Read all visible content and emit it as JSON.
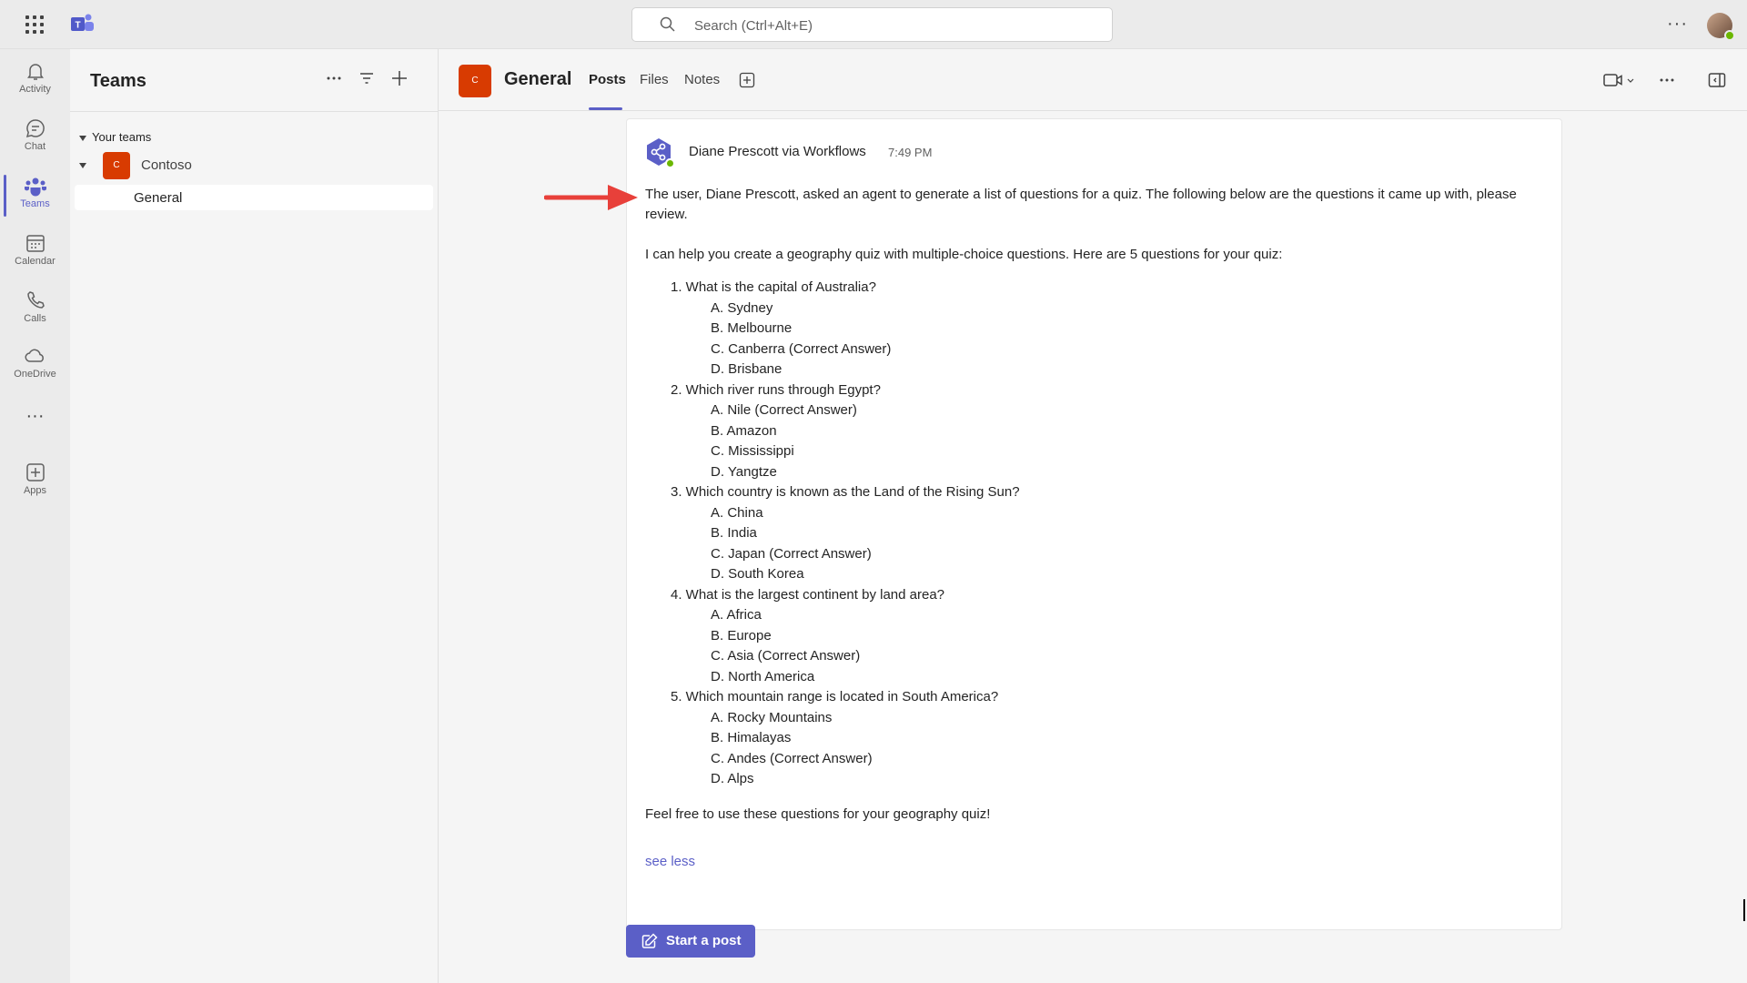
{
  "topbar": {
    "search_placeholder": "Search (Ctrl+Alt+E)",
    "more_label": "···"
  },
  "rail": {
    "items": [
      {
        "label": "Activity",
        "icon": "bell-icon"
      },
      {
        "label": "Chat",
        "icon": "chat-icon"
      },
      {
        "label": "Teams",
        "icon": "teams-icon",
        "active": true
      },
      {
        "label": "Calendar",
        "icon": "calendar-icon"
      },
      {
        "label": "Calls",
        "icon": "phone-icon"
      },
      {
        "label": "OneDrive",
        "icon": "cloud-icon"
      },
      {
        "label": "Apps",
        "icon": "add-app-icon"
      }
    ],
    "more_label": "···"
  },
  "teams_panel": {
    "title": "Teams",
    "section": "Your teams",
    "team": {
      "initial": "C",
      "name": "Contoso"
    },
    "channel": "General"
  },
  "channel_header": {
    "initial": "C",
    "name": "General",
    "tabs": [
      "Posts",
      "Files",
      "Notes"
    ],
    "active_tab": "Posts"
  },
  "post": {
    "author": "Diane Prescott via Workflows",
    "time": "7:49 PM",
    "intro": "The user, Diane Prescott, asked an agent to generate a list of questions for a quiz. The following below are the questions it came up with, please review.",
    "lead": "I can help you create a geography quiz with multiple-choice questions. Here are 5 questions for your quiz:",
    "questions": [
      {
        "text": "1. What is the capital of Australia?",
        "options": [
          "A. Sydney",
          "B. Melbourne",
          "C. Canberra (Correct Answer)",
          "D. Brisbane"
        ]
      },
      {
        "text": "2. Which river runs through Egypt?",
        "options": [
          "A. Nile (Correct Answer)",
          "B. Amazon",
          "C. Mississippi",
          "D. Yangtze"
        ]
      },
      {
        "text": "3. Which country is known as the Land of the Rising Sun?",
        "options": [
          "A. China",
          "B. India",
          "C. Japan (Correct Answer)",
          "D. South Korea"
        ]
      },
      {
        "text": "4. What is the largest continent by land area?",
        "options": [
          "A. Africa",
          "B. Europe",
          "C. Asia (Correct Answer)",
          "D. North America"
        ]
      },
      {
        "text": "5. Which mountain range is located in South America?",
        "options": [
          "A. Rocky Mountains",
          "B. Himalayas",
          "C. Andes (Correct Answer)",
          "D. Alps"
        ]
      }
    ],
    "closing": "Feel free to use these questions for your geography quiz!",
    "see_less": "see less"
  },
  "composer": {
    "start_post": "Start a post"
  },
  "colors": {
    "accent": "#5b5fc7",
    "team_tile": "#d83b01",
    "arrow": "#e8403a",
    "presence": "#6bb700"
  }
}
